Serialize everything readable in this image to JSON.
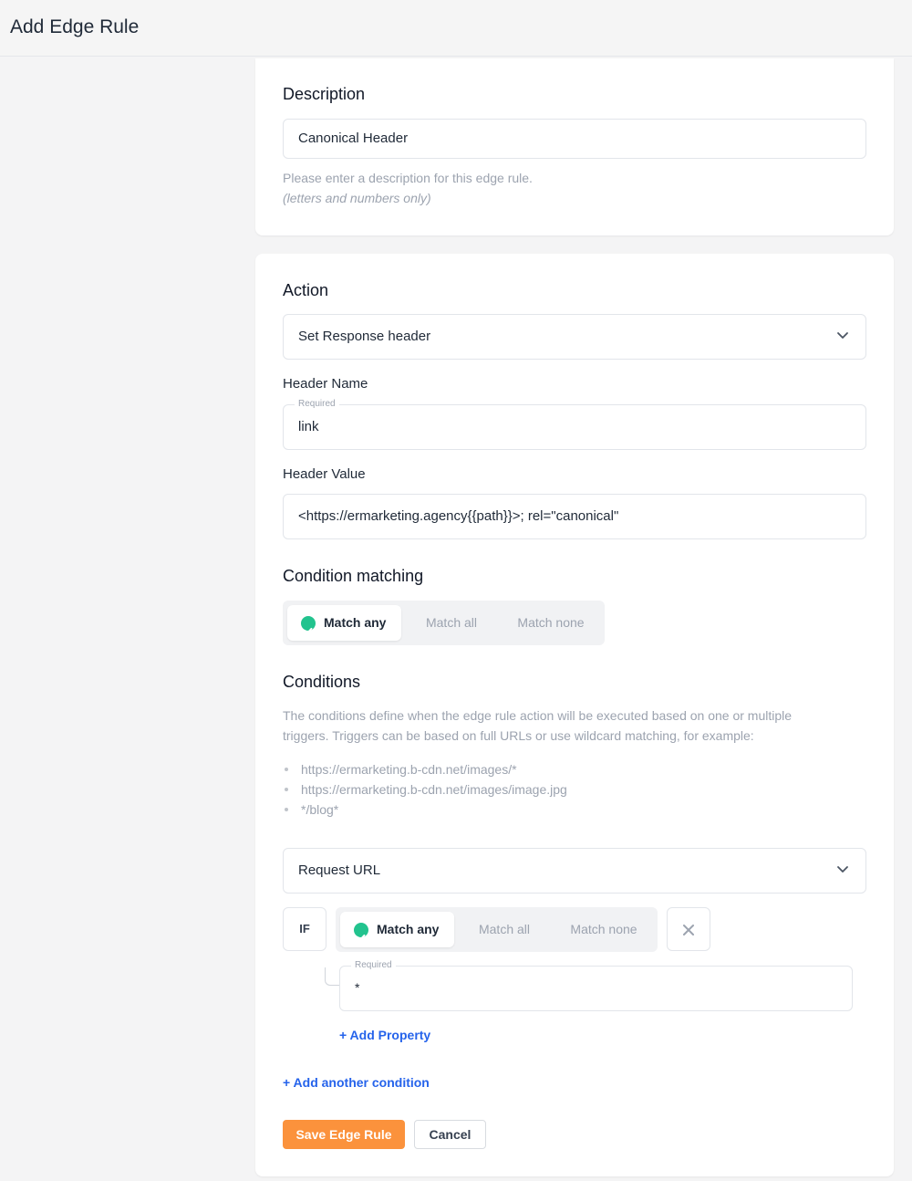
{
  "page": {
    "title": "Add Edge Rule"
  },
  "description": {
    "heading": "Description",
    "value": "Canonical Header",
    "help_line1": "Please enter a description for this edge rule.",
    "help_line2": "(letters and numbers only)"
  },
  "action": {
    "heading": "Action",
    "selected": "Set Response header",
    "header_name_label": "Header Name",
    "header_name_required": "Required",
    "header_name_value": "link",
    "header_value_label": "Header Value",
    "header_value_value": "<https://ermarketing.agency{{path}}>; rel=\"canonical\""
  },
  "condition_matching": {
    "heading": "Condition matching",
    "options": [
      "Match any",
      "Match all",
      "Match none"
    ],
    "selected": "Match any"
  },
  "conditions": {
    "heading": "Conditions",
    "intro_line1": "The conditions define when the edge rule action will be executed based on one or multiple",
    "intro_line2": "triggers. Triggers can be based on full URLs or use wildcard matching, for example:",
    "examples": [
      "https://ermarketing.b-cdn.net/images/*",
      "https://ermarketing.b-cdn.net/images/image.jpg",
      "*/blog*"
    ],
    "trigger_type": "Request URL",
    "if_label": "IF",
    "match_options": [
      "Match any",
      "Match all",
      "Match none"
    ],
    "match_selected": "Match any",
    "remove_icon": "close-icon",
    "property_required": "Required",
    "property_value": "*",
    "add_property": "+ Add Property",
    "add_condition": "+ Add another condition"
  },
  "buttons": {
    "save": "Save Edge Rule",
    "cancel": "Cancel"
  },
  "colors": {
    "accent": "#fb923c",
    "link": "#2563eb",
    "check": "#22c38e"
  }
}
